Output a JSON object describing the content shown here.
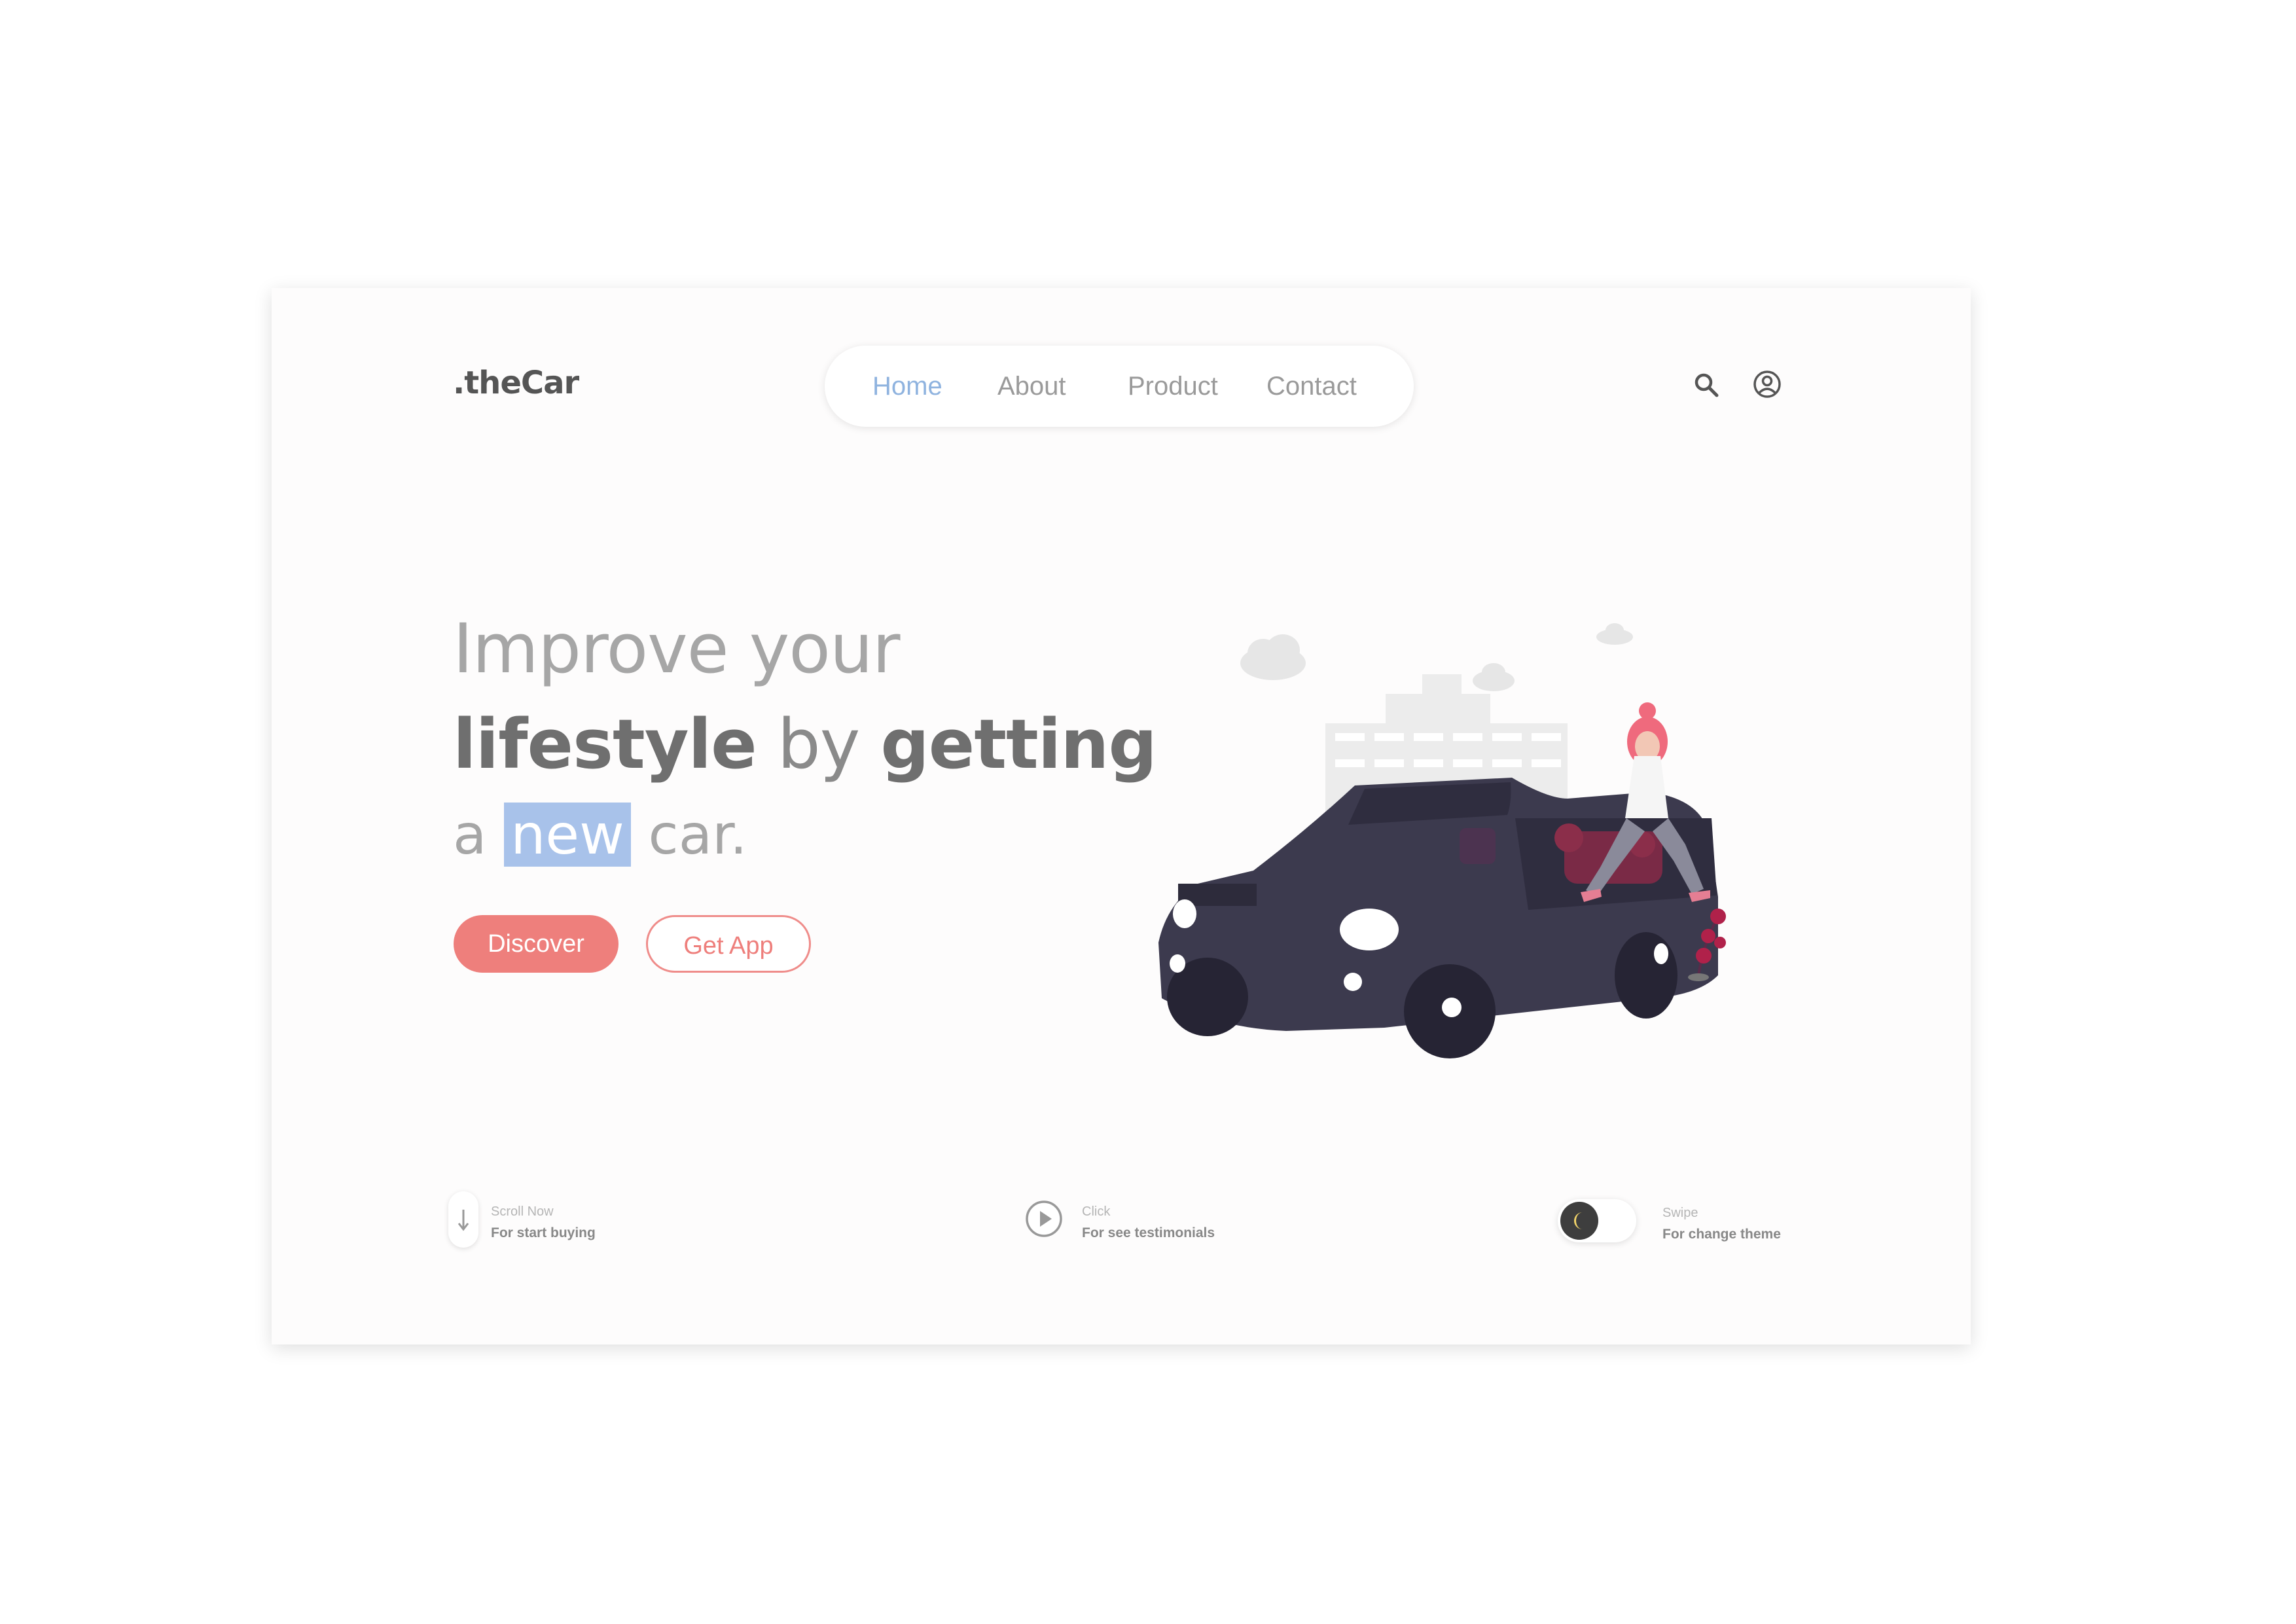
{
  "brand": {
    "logo": ".theCar"
  },
  "nav": {
    "items": [
      "Home",
      "About",
      "Product",
      "Contact"
    ],
    "active_index": 0
  },
  "header_icons": [
    "search-icon",
    "user-account-icon"
  ],
  "hero": {
    "line1": "Improve your",
    "line2": {
      "w1": "lifestyle",
      "w2": "by",
      "w3": "getting"
    },
    "line3": {
      "w1": "a",
      "highlight": "new",
      "w2": "car."
    }
  },
  "buttons": {
    "primary": "Discover",
    "secondary": "Get App"
  },
  "features": [
    {
      "icon": "arrow-down-icon",
      "caption": "Scroll Now",
      "label": "For start buying"
    },
    {
      "icon": "play-icon",
      "caption": "Click",
      "label": "For see testimonials"
    },
    {
      "icon": "moon-toggle-icon",
      "caption": "Swipe",
      "label": "For change theme"
    }
  ],
  "colors": {
    "accent": "#ee7f7c",
    "nav_active": "#8fb3df",
    "highlight": "#a8c2ea",
    "car": "#3c3a4e"
  }
}
